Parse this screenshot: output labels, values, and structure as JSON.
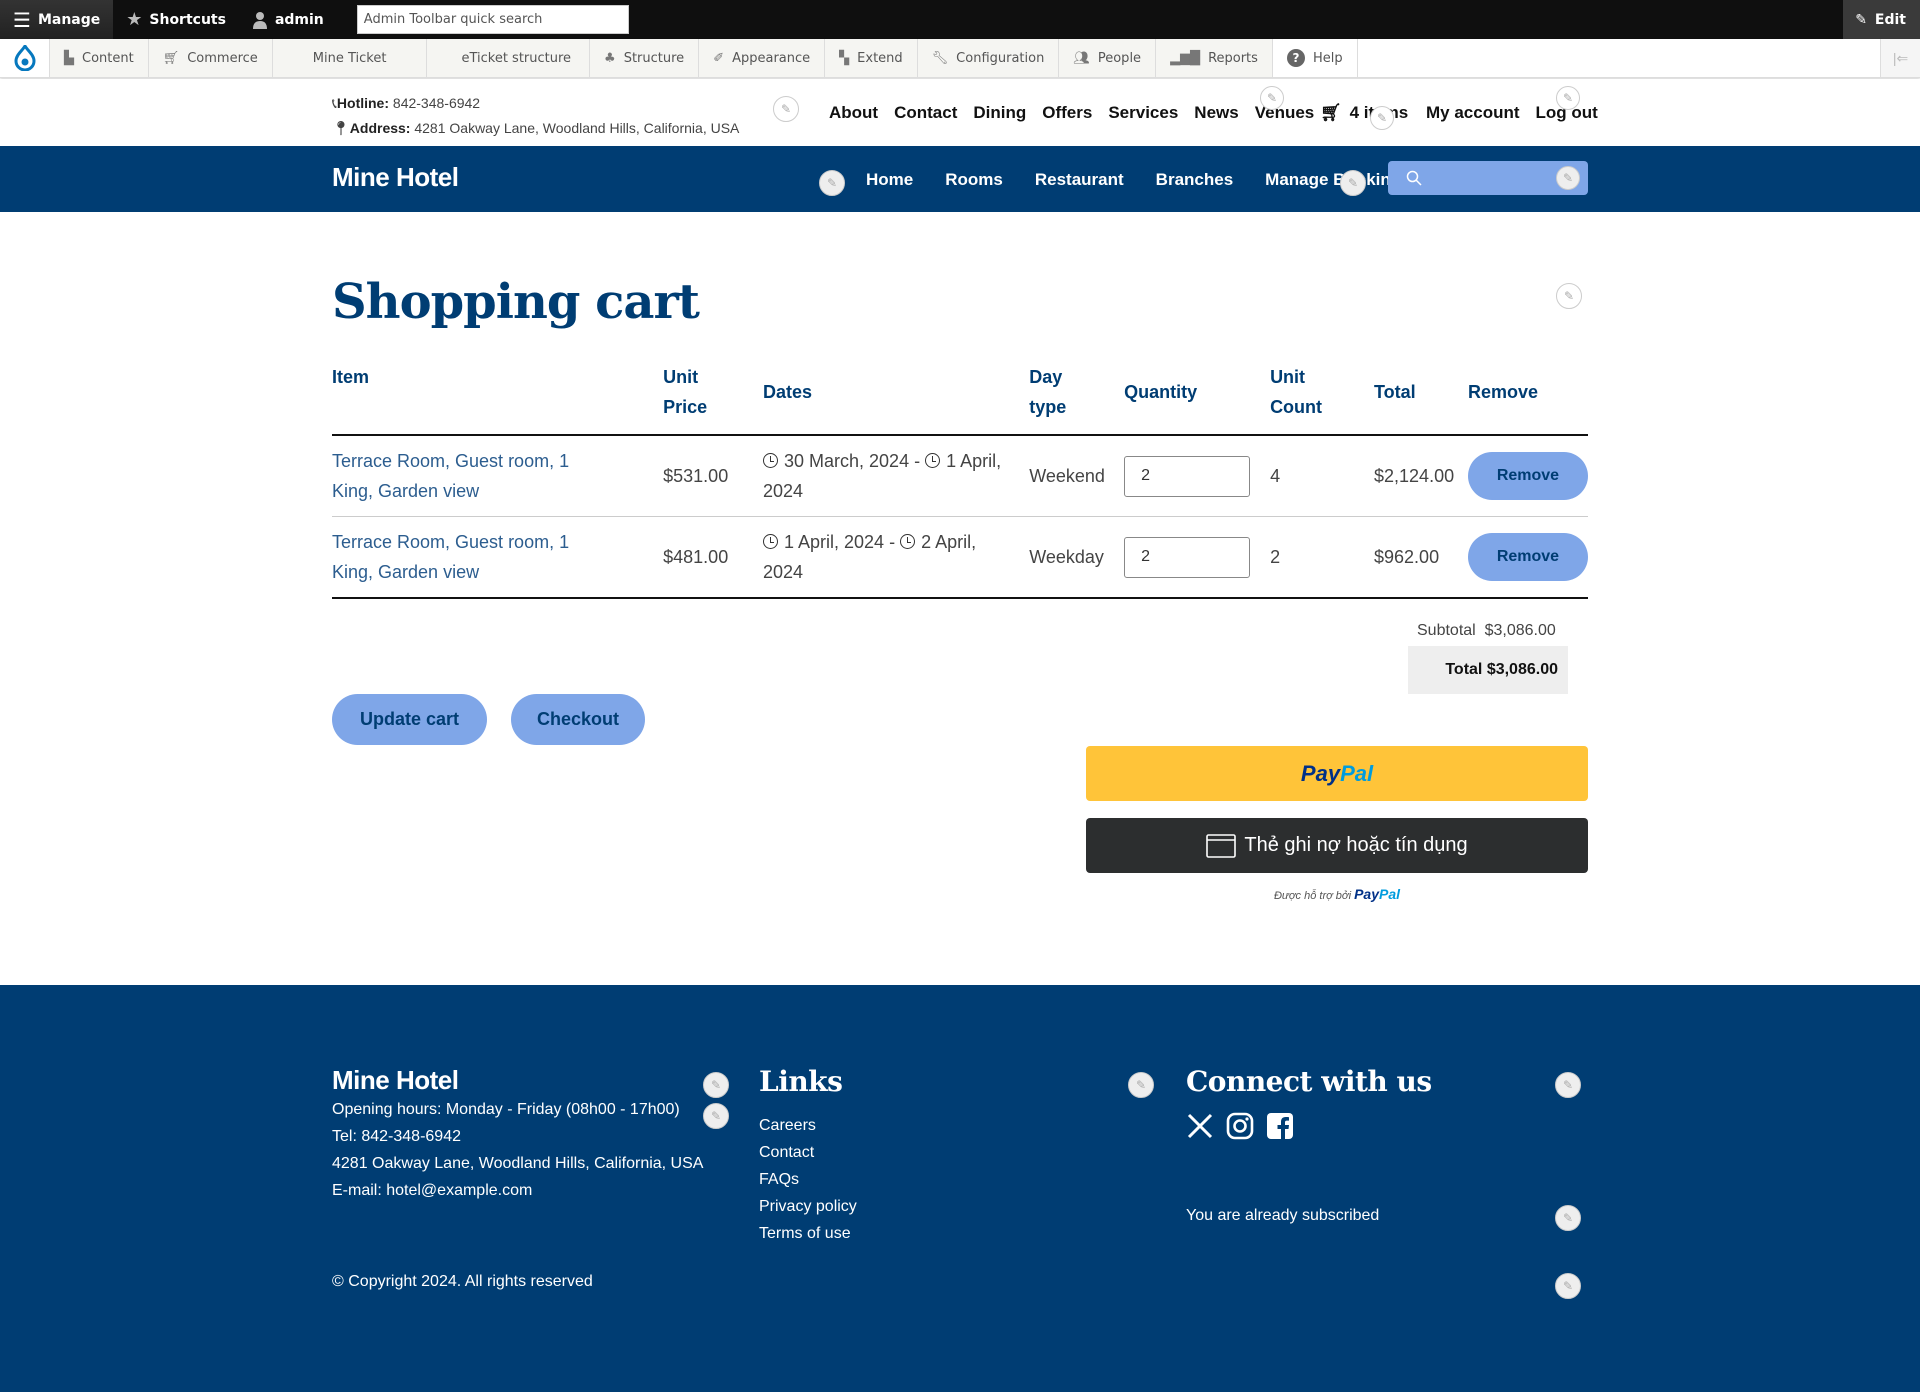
{
  "admin_toolbar": {
    "manage_label": "Manage",
    "shortcuts_label": "Shortcuts",
    "user_label": "admin",
    "search_placeholder": "Admin Toolbar quick search",
    "edit_label": "Edit",
    "tray_items": [
      {
        "label": "Content",
        "icon": "file-icon"
      },
      {
        "label": "Commerce",
        "icon": "cart-icon"
      },
      {
        "label": "Mine Ticket",
        "icon": ""
      },
      {
        "label": "eTicket structure",
        "icon": ""
      },
      {
        "label": "Structure",
        "icon": "sitemap-icon"
      },
      {
        "label": "Appearance",
        "icon": "brush-icon"
      },
      {
        "label": "Extend",
        "icon": "puzzle-icon"
      },
      {
        "label": "Configuration",
        "icon": "wrench-icon"
      },
      {
        "label": "People",
        "icon": "people-icon"
      },
      {
        "label": "Reports",
        "icon": "bar-chart-icon"
      },
      {
        "label": "Help",
        "icon": "question-icon"
      }
    ]
  },
  "header": {
    "hotline_label": "Hotline:",
    "hotline": "842-348-6942",
    "address_label": "Address:",
    "address": "4281 Oakway Lane, Woodland Hills, California, USA",
    "top_nav": [
      "About",
      "Contact",
      "Dining",
      "Offers",
      "Services",
      "News",
      "Venues"
    ],
    "cart_label": "4 items",
    "account_nav": [
      "My account",
      "Log out"
    ],
    "brand": "Mine Hotel",
    "main_nav": [
      "Home",
      "Rooms",
      "Restaurant",
      "Branches",
      "Manage Booking"
    ],
    "search_placeholder": ""
  },
  "cart": {
    "title": "Shopping cart",
    "columns": [
      "Item",
      "Unit Price",
      "Dates",
      "Day type",
      "Quantity",
      "Unit Count",
      "Total",
      "Remove"
    ],
    "rows": [
      {
        "item": "Terrace Room, Guest room, 1 King, Garden view",
        "unit_price": "$531.00",
        "date_from": "30 March, 2024 -",
        "date_to": "1 April, 2024",
        "day_type": "Weekend",
        "quantity": "2",
        "unit_count": "4",
        "total": "$2,124.00",
        "remove_label": "Remove"
      },
      {
        "item": "Terrace Room, Guest room, 1 King, Garden view",
        "unit_price": "$481.00",
        "date_from": "1 April, 2024 -",
        "date_to": "2 April, 2024",
        "day_type": "Weekday",
        "quantity": "2",
        "unit_count": "2",
        "total": "$962.00",
        "remove_label": "Remove"
      }
    ],
    "subtotal_label": "Subtotal",
    "subtotal": "$3,086.00",
    "total_label": "Total",
    "total": "$3,086.00",
    "update_label": "Update cart",
    "checkout_label": "Checkout",
    "paypal": {
      "pay": "Pay",
      "pal": "Pal",
      "card_label": "Thẻ ghi nợ hoặc tín dụng",
      "powered_by": "Được hỗ trợ bởi"
    }
  },
  "footer": {
    "brand": "Mine Hotel",
    "hours": "Opening hours: Monday - Friday (08h00 - 17h00)",
    "tel": "Tel: 842-348-6942",
    "address": "4281 Oakway Lane, Woodland Hills, California, USA",
    "email": "E-mail: hotel@example.com",
    "links_heading": "Links",
    "links": [
      "Careers",
      "Contact",
      "FAQs",
      "Privacy policy",
      "Terms of use"
    ],
    "connect_heading": "Connect with us",
    "social": [
      "x-icon",
      "instagram-icon",
      "facebook-icon"
    ],
    "subscribed": "You are already subscribed",
    "copyright": "© Copyright 2024. All rights reserved"
  },
  "colors": {
    "brand_blue": "#003d73",
    "button_blue": "#7fa6e8",
    "paypal_yellow": "#ffc439",
    "toolbar_black": "#0f0f0f"
  }
}
